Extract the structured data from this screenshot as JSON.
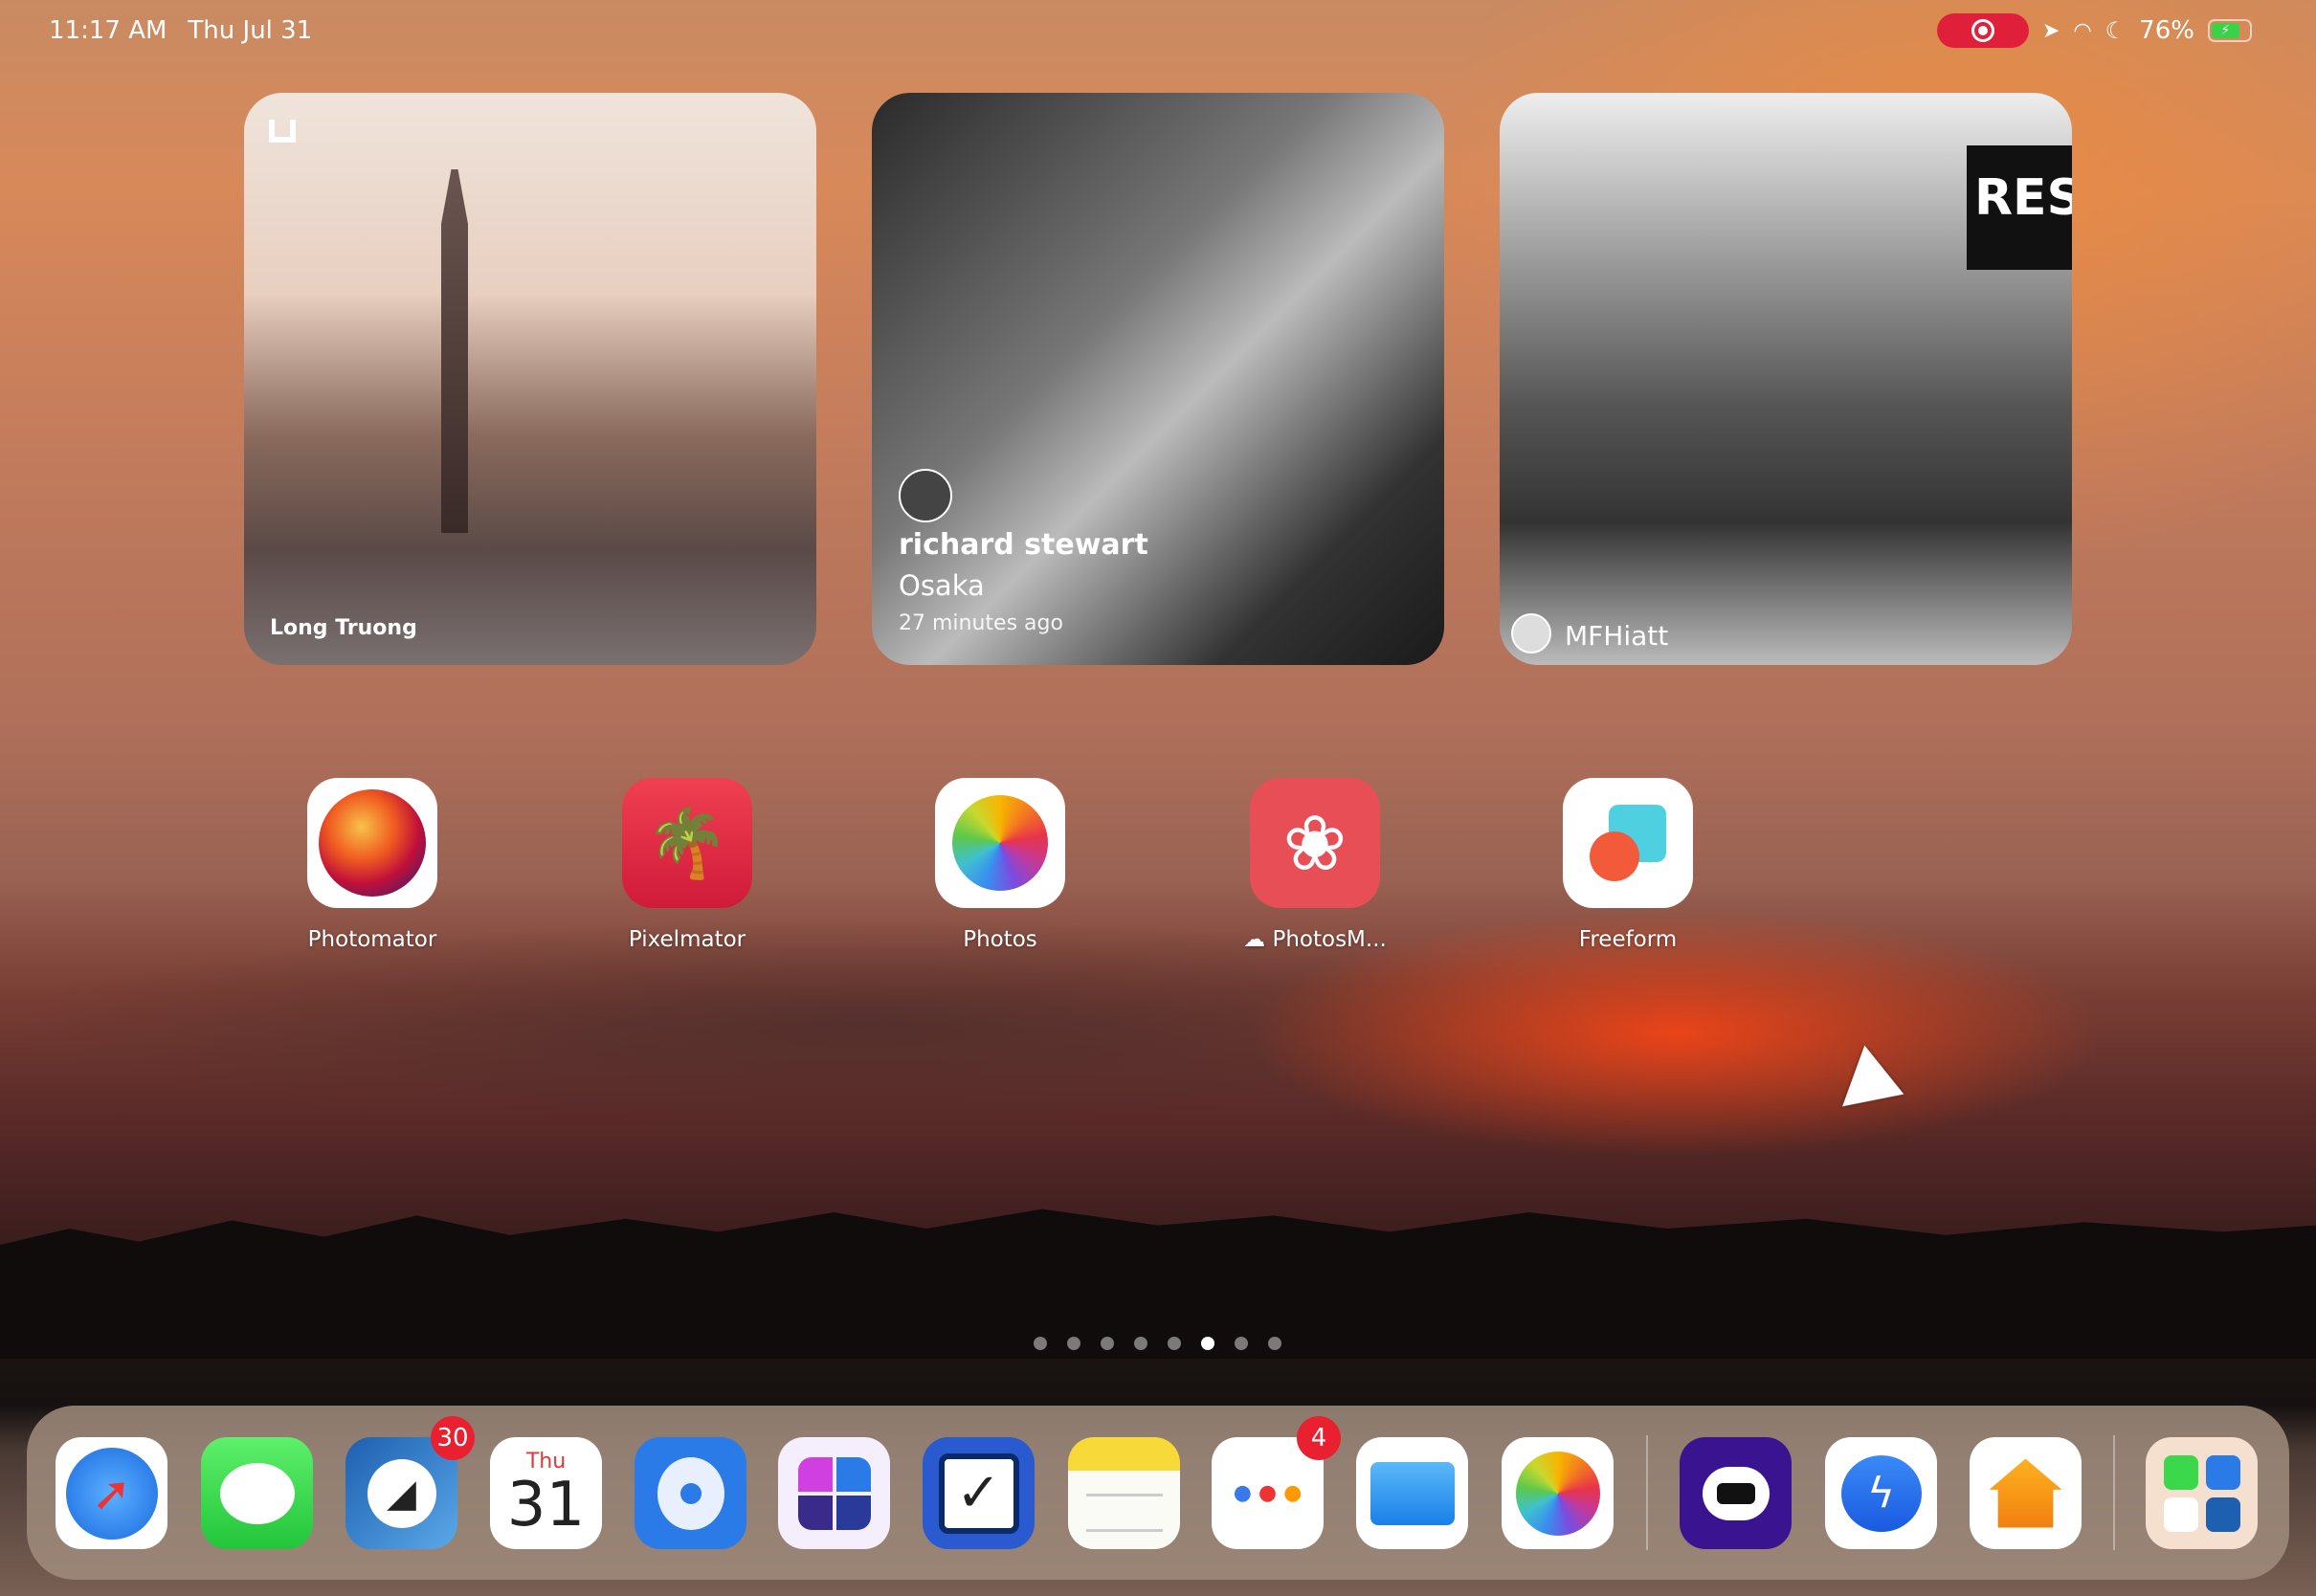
{
  "status_bar": {
    "time": "11:17 AM",
    "date": "Thu Jul 31",
    "battery": "76%",
    "battery_level": 0.76,
    "recording_color": "#e0203a",
    "icons": [
      "screen-recording-icon",
      "location-icon",
      "wifi-icon",
      "focus-moon-icon",
      "battery-charging-icon"
    ]
  },
  "widgets": [
    {
      "author": "Long Truong",
      "icon": "unsplash-icon"
    },
    {
      "author": "richard stewart",
      "location": "Osaka",
      "time": "27 minutes ago"
    },
    {
      "author": "MFHiatt",
      "sign_text": "RESIS"
    }
  ],
  "apps": [
    {
      "label": "Photomator",
      "icon": "photomator-icon"
    },
    {
      "label": "Pixelmator",
      "icon": "pixelmator-icon"
    },
    {
      "label": "Photos",
      "icon": "photos-icon"
    },
    {
      "label": "PhotosM...",
      "icon": "photosm-icon",
      "status_icon": "icloud-download-icon"
    },
    {
      "label": "Freeform",
      "icon": "freeform-icon"
    }
  ],
  "pages": {
    "count": 8,
    "current": 6
  },
  "dock": [
    {
      "icon": "safari-icon"
    },
    {
      "icon": "messages-icon"
    },
    {
      "icon": "airmail-icon",
      "badge": "30"
    },
    {
      "icon": "calendar-icon",
      "day": "Thu",
      "date": "31"
    },
    {
      "icon": "tweetbot-icon"
    },
    {
      "icon": "craft-icon"
    },
    {
      "icon": "omnifocus-icon"
    },
    {
      "icon": "notes-icon"
    },
    {
      "icon": "reminders-icon",
      "badge": "4"
    },
    {
      "icon": "files-icon"
    },
    {
      "icon": "photos-icon"
    },
    {
      "icon": "cloud-app-icon"
    },
    {
      "icon": "messenger-icon"
    },
    {
      "icon": "home-icon"
    },
    {
      "icon": "app-library-icon"
    }
  ]
}
